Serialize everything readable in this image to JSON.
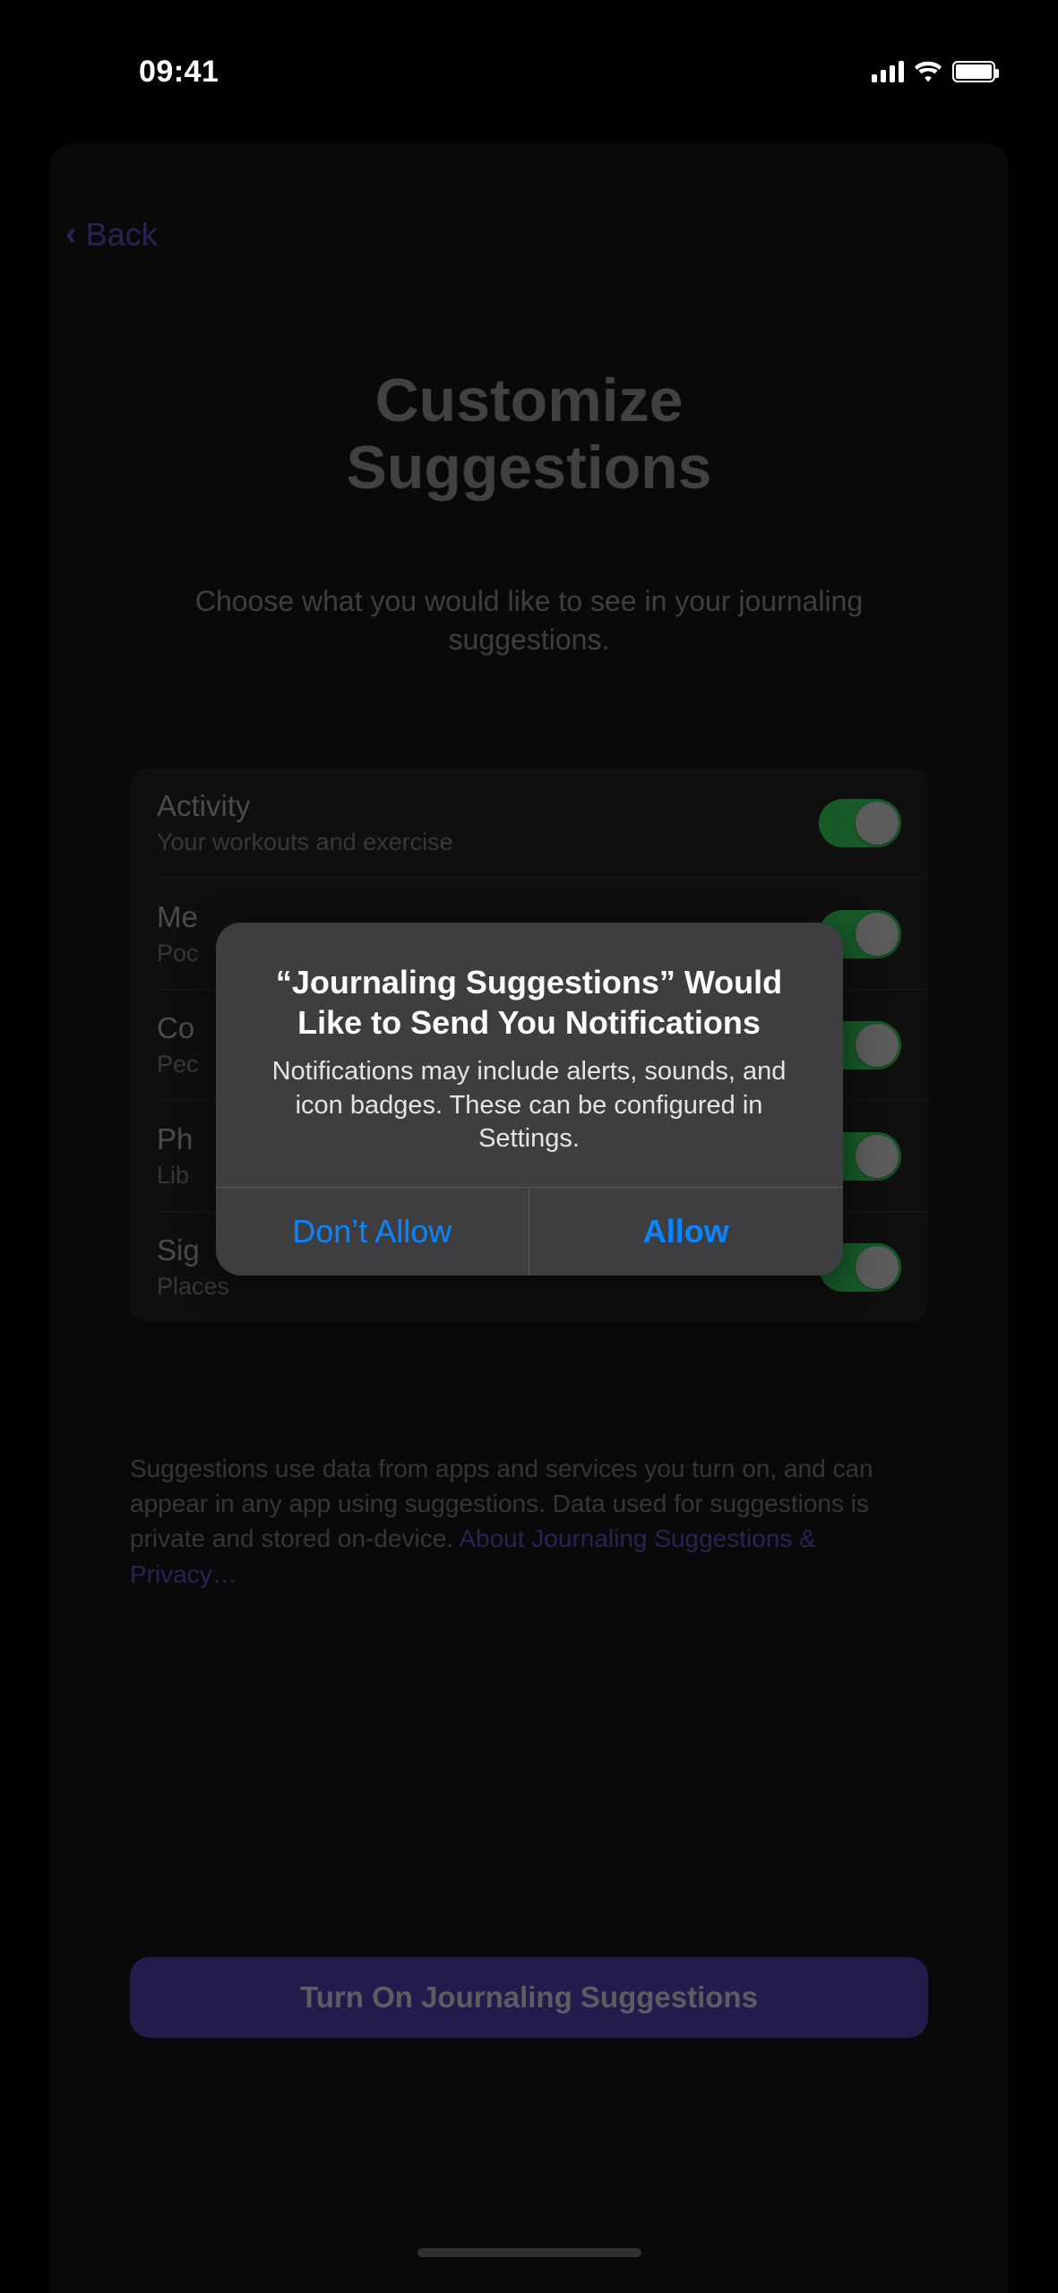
{
  "status": {
    "time": "09:41"
  },
  "nav": {
    "back_label": "Back"
  },
  "header": {
    "title_line1": "Customize",
    "title_line2": "Suggestions",
    "subtitle": "Choose what you would like to see in your journaling suggestions."
  },
  "settings": [
    {
      "title": "Activity",
      "subtitle": "Your workouts and exercise",
      "on": true
    },
    {
      "title": "Me",
      "subtitle": "Poc",
      "on": true
    },
    {
      "title": "Co",
      "subtitle": "Pec",
      "on": true
    },
    {
      "title": "Ph",
      "subtitle": "Lib",
      "on": true
    },
    {
      "title": "Sig",
      "subtitle": "Places",
      "on": true
    }
  ],
  "footer": {
    "text": "Suggestions use data from apps and services you turn on, and can appear in any app using suggestions. Data used for suggestions is private and stored on-device. ",
    "link": "About Journaling Suggestions & Privacy…"
  },
  "cta": {
    "label": "Turn On Journaling Suggestions"
  },
  "alert": {
    "title": "“Journaling Suggestions” Would Like to Send You Notifications",
    "message": "Notifications may include alerts, sounds, and icon badges. These can be configured in Settings.",
    "deny": "Don’t Allow",
    "allow": "Allow"
  }
}
